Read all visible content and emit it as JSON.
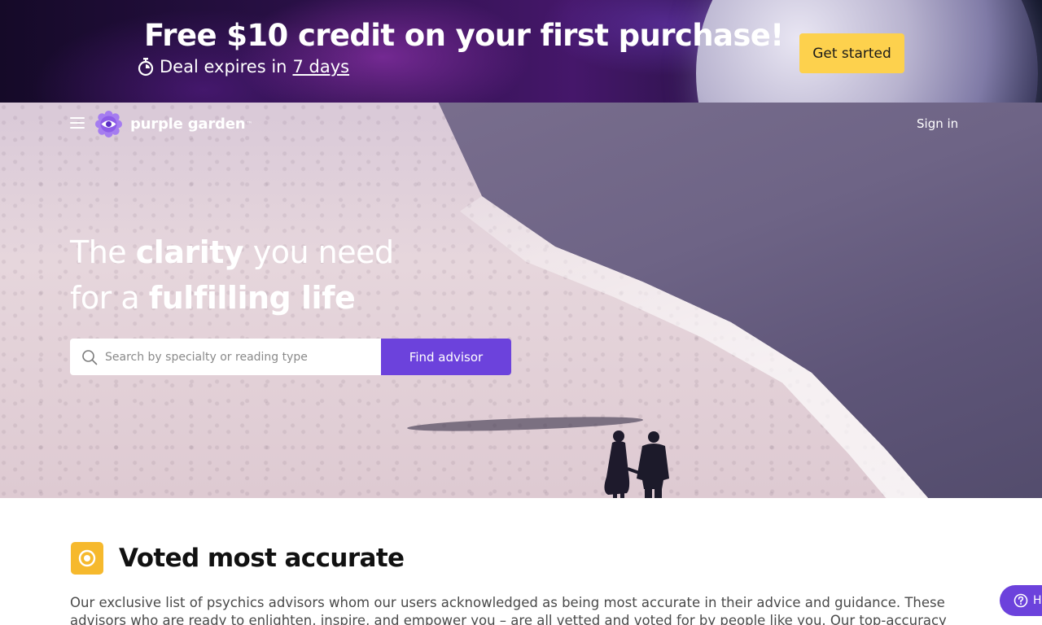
{
  "promo": {
    "title": "Free $10 credit on your first purchase!",
    "deal_prefix": "Deal expires in",
    "deal_days": "7 days",
    "cta_label": "Get started",
    "cta_color": "#fdd14d"
  },
  "nav": {
    "menu_icon": "hamburger-menu-icon",
    "logo_text": "purple garden",
    "logo_tm": "™",
    "signin_label": "Sign in"
  },
  "hero": {
    "line1_a": "The",
    "line1_b": "clarity",
    "line1_c": "you need",
    "line2_a": "for a",
    "line2_b": "fulfilling life",
    "search_placeholder": "Search by specialty or reading type",
    "search_value": "",
    "find_button": "Find advisor",
    "accent_color": "#6c42dc"
  },
  "section": {
    "icon": "target-icon",
    "title": "Voted most accurate",
    "text": "Our exclusive list of psychics advisors whom our users acknowledged as being most accurate in their advice and guidance. These advisors who are ready to enlighten, inspire, and empower you – are all vetted and voted for by people like you. Our top-accuracy"
  },
  "help": {
    "label": "H",
    "icon": "question-circle-icon"
  }
}
